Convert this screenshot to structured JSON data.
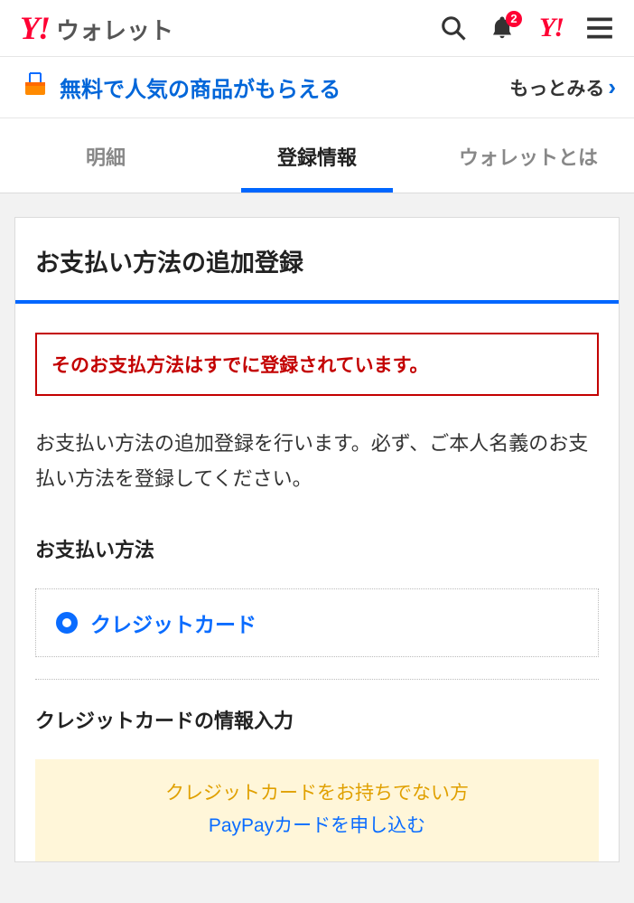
{
  "header": {
    "logo_prefix": "Y!",
    "logo_text": "ウォレット",
    "notification_count": "2",
    "brand_small": "Y!"
  },
  "promo": {
    "text": "無料で人気の商品がもらえる",
    "more": "もっとみる"
  },
  "tabs": {
    "items": [
      {
        "label": "明細"
      },
      {
        "label": "登録情報"
      },
      {
        "label": "ウォレットとは"
      }
    ]
  },
  "main": {
    "title": "お支払い方法の追加登録",
    "error": "そのお支払方法はすでに登録されています。",
    "intro": "お支払い方法の追加登録を行います。必ず、ご本人名義のお支払い方法を登録してください。",
    "method_label": "お支払い方法",
    "radio_option": "クレジットカード",
    "cc_section_label": "クレジットカードの情報入力",
    "cc_promo_line1": "クレジットカードをお持ちでない方",
    "cc_promo_line2": "PayPayカードを申し込む"
  }
}
